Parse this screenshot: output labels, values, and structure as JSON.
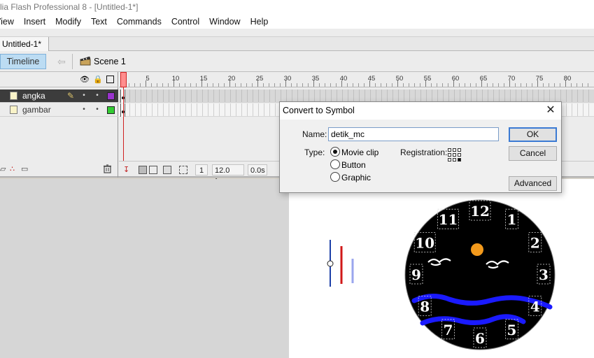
{
  "app": {
    "title": "lia Flash Professional 8 - [Untitled-1*]"
  },
  "menubar": [
    "View",
    "Insert",
    "Modify",
    "Text",
    "Commands",
    "Control",
    "Window",
    "Help"
  ],
  "document_tab": "Untitled-1*",
  "editbar": {
    "timeline_button": "Timeline",
    "scene_label": "Scene 1"
  },
  "timeline": {
    "ruler_labels": [
      "1",
      "5",
      "10",
      "15",
      "20",
      "25",
      "30",
      "35",
      "40",
      "45",
      "50",
      "55",
      "60",
      "65",
      "70",
      "75",
      "80"
    ],
    "layers": [
      {
        "name": "angka",
        "selected": true,
        "color": "#9933cc"
      },
      {
        "name": "gambar",
        "selected": false,
        "color": "#33cc33"
      }
    ],
    "footer": {
      "current_frame": "1",
      "frame_rate": "12.0 fps",
      "elapsed_time": "0.0s"
    }
  },
  "dialog": {
    "title": "Convert to Symbol",
    "name_label": "Name:",
    "name_value": "detik_mc",
    "type_label": "Type:",
    "type_options": [
      "Movie clip",
      "Button",
      "Graphic"
    ],
    "selected_type": "Movie clip",
    "registration_label": "Registration:",
    "ok_button": "OK",
    "cancel_button": "Cancel",
    "advanced_button": "Advanced"
  },
  "clock": {
    "numbers": [
      "12",
      "1",
      "2",
      "3",
      "4",
      "5",
      "6",
      "7",
      "8",
      "9",
      "10",
      "11"
    ],
    "face_color": "#000000",
    "sun_color": "#f39a1c",
    "wave_color": "#1a1aff",
    "hand_colors": [
      "#1c3fa8",
      "#d01818",
      "#9aa6ee"
    ]
  }
}
